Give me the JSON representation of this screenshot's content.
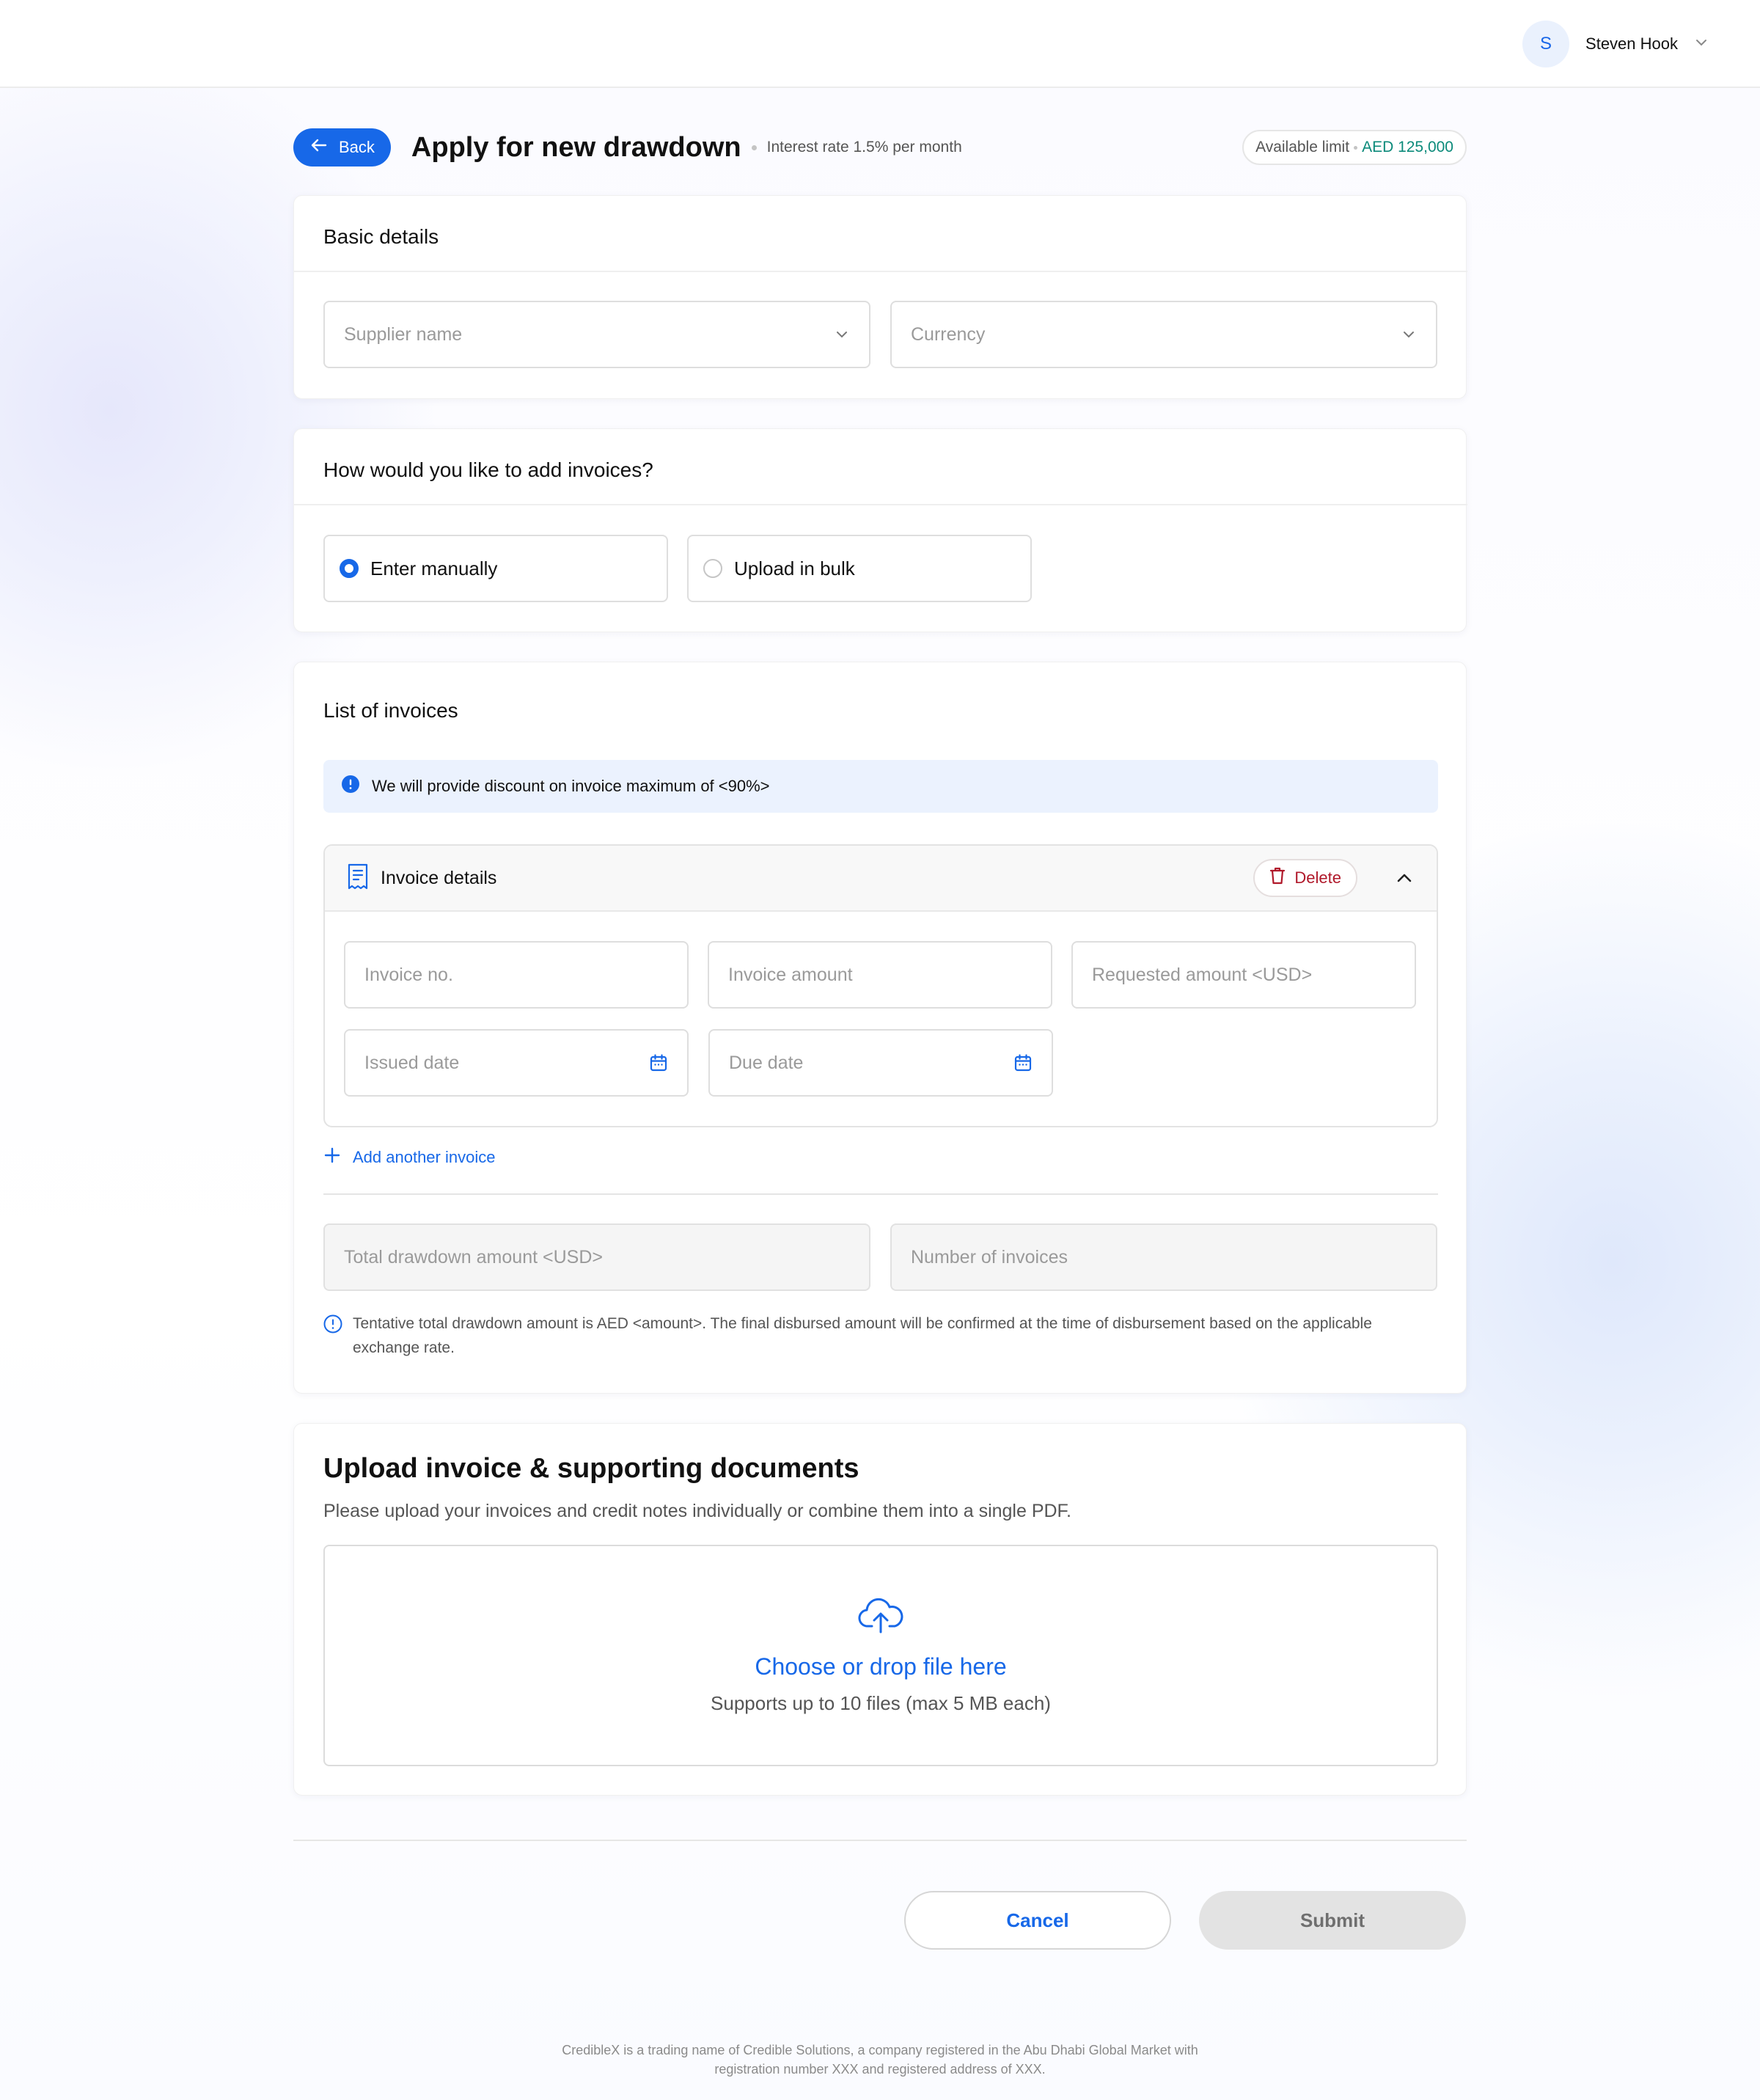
{
  "topbar": {
    "user": {
      "initial": "S",
      "name": "Steven Hook"
    }
  },
  "header": {
    "back_label": "Back",
    "title": "Apply for new drawdown",
    "interest": "Interest rate 1.5% per month",
    "limit_label": "Available limit",
    "limit_value": "AED 125,000"
  },
  "basic": {
    "title": "Basic details",
    "supplier_placeholder": "Supplier name",
    "currency_placeholder": "Currency"
  },
  "method": {
    "title": "How would you like to add invoices?",
    "options": [
      {
        "label": "Enter manually",
        "selected": true
      },
      {
        "label": "Upload in bulk",
        "selected": false
      }
    ]
  },
  "invoices": {
    "title": "List of invoices",
    "info": "We will provide discount on invoice maximum of <90%>",
    "item": {
      "title": "Invoice details",
      "delete_label": "Delete",
      "fields": {
        "invoice_no": "Invoice no.",
        "invoice_amount": "Invoice amount",
        "requested_amount": "Requested amount <USD>",
        "issued_date": "Issued date",
        "due_date": "Due date"
      }
    },
    "add_label": "Add another invoice",
    "total_placeholder": "Total drawdown amount <USD>",
    "count_placeholder": "Number of invoices",
    "note": "Tentative total drawdown amount is AED <amount>. The final disbursed amount will be confirmed at the time of disbursement based on the applicable exchange rate."
  },
  "upload": {
    "title": "Upload invoice & supporting documents",
    "subtitle": "Please upload your invoices and credit notes individually or combine them into a single PDF.",
    "drop_title": "Choose or drop file here",
    "drop_hint": "Supports up to 10 files (max 5 MB each)"
  },
  "actions": {
    "cancel": "Cancel",
    "submit": "Submit"
  },
  "footer": {
    "line1": "CredibleX is a trading name of Credible Solutions, a company registered in the Abu Dhabi Global Market with",
    "line2": "registration number XXX and registered address of XXX."
  },
  "colors": {
    "primary": "#1768e8",
    "limit": "#0b8a7a",
    "danger": "#b0182a",
    "info_bg": "#ebf2fe"
  },
  "icons": [
    "arrow-left-icon",
    "chevron-down-icon",
    "info-icon",
    "receipt-icon",
    "trash-icon",
    "chevron-up-icon",
    "plus-icon",
    "calendar-icon",
    "cloud-upload-icon"
  ]
}
